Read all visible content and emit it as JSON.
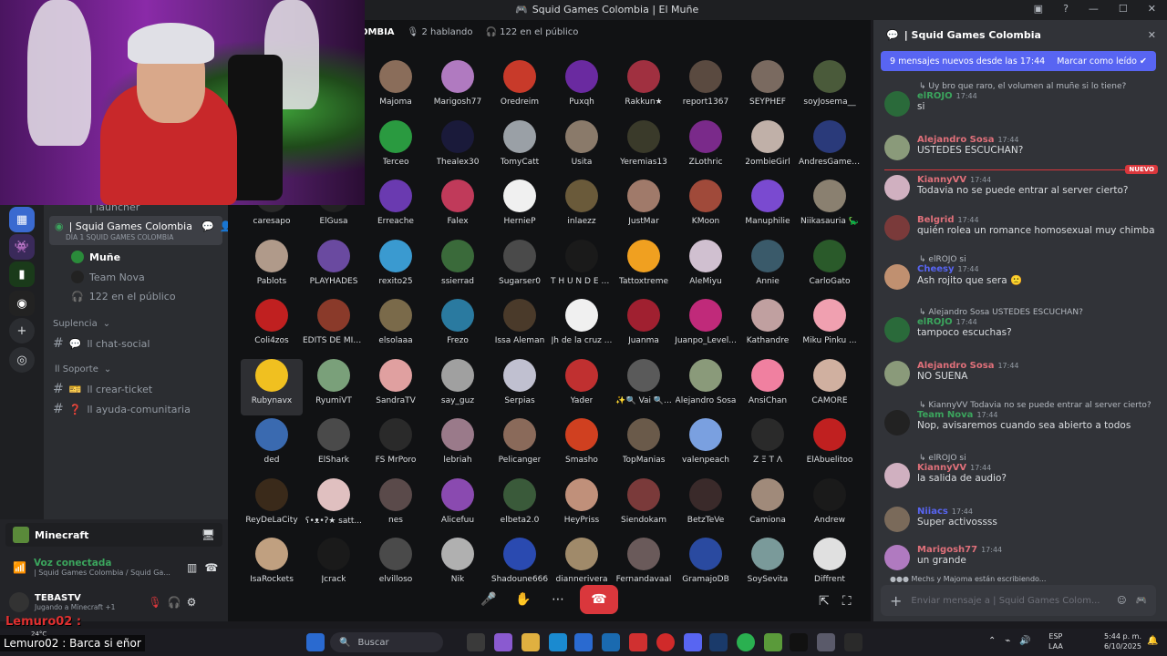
{
  "window": {
    "title": "Squid Games Colombia | El Muñe"
  },
  "stage": {
    "header_partial": "OMBIA",
    "speaking": "2 hablando",
    "public": "122 en el público"
  },
  "sidebar": {
    "partial_launcher": "| launcher",
    "active_channel": "| Squid Games Colombia",
    "active_sub": "DÍA 1 SQUID GAMES COLOMBIA",
    "members": [
      "Muñe",
      "Team Nova"
    ],
    "public_count": "122 en el público",
    "cat_suplencia": "Suplencia",
    "chat_social": "ll chat-social",
    "cat_soporte": "ll Soporte",
    "crear_ticket": "ll crear-ticket",
    "ayuda": "ll ayuda-comunitaria"
  },
  "usercard": {
    "game": "Minecraft",
    "voice_status": "Voz conectada",
    "voice_channel": "| Squid Games Colombia / Squid Ga...",
    "user": "TEBASTV",
    "activity": "Jugando a Minecraft +1"
  },
  "participants": [
    {
      "n": "Majoma",
      "c": "#8a6d5a"
    },
    {
      "n": "Marigosh77",
      "c": "#b07ac0"
    },
    {
      "n": "Oredreim",
      "c": "#c83a2a"
    },
    {
      "n": "Puxqh",
      "c": "#6a2aa0"
    },
    {
      "n": "Rakkun★",
      "c": "#a03040"
    },
    {
      "n": "report1367",
      "c": "#5a4a40"
    },
    {
      "n": "SEYPHEF",
      "c": "#7a6a60"
    },
    {
      "n": "soyJosema__",
      "c": "#4a5a3a"
    },
    {
      "n": "Terceo",
      "c": "#2a9a40"
    },
    {
      "n": "Thealex30",
      "c": "#1a1a3a"
    },
    {
      "n": "TomyCatt",
      "c": "#9aa0a6"
    },
    {
      "n": "Usita",
      "c": "#8a7a6a"
    },
    {
      "n": "Yeremias13",
      "c": "#3a3a2a"
    },
    {
      "n": "ZLothric",
      "c": "#7a2a8a"
    },
    {
      "n": "2ombieGirl",
      "c": "#c0b0a8"
    },
    {
      "n": "AndresGamer...",
      "c": "#2a3a7a"
    },
    {
      "n": "caresapo",
      "c": "#2a2a2a"
    },
    {
      "n": "ElGusa",
      "c": "#222"
    },
    {
      "n": "Erreache",
      "c": "#6a3ab0"
    },
    {
      "n": "Falex",
      "c": "#c03a5a"
    },
    {
      "n": "HernieP",
      "c": "#f0f0f0"
    },
    {
      "n": "inlaezz",
      "c": "#6a5a3a"
    },
    {
      "n": "JustMar",
      "c": "#a07a6a"
    },
    {
      "n": "KMoon",
      "c": "#a04a3a"
    },
    {
      "n": "Manuphilie",
      "c": "#7a4ad0"
    },
    {
      "n": "Niikasauria 🦕",
      "c": "#8a8070"
    },
    {
      "n": "Pablots",
      "c": "#b09a8a"
    },
    {
      "n": "PLAYHADES",
      "c": "#6a4aa0"
    },
    {
      "n": "rexito25",
      "c": "#3a9ad0"
    },
    {
      "n": "ssierrad",
      "c": "#3a6a3a"
    },
    {
      "n": "Sugarser0",
      "c": "#4a4a4a"
    },
    {
      "n": "T H U N D E R...",
      "c": "#1a1a1a"
    },
    {
      "n": "Tattoxtreme",
      "c": "#f0a020"
    },
    {
      "n": "AleMiyu",
      "c": "#d0c0d0"
    },
    {
      "n": "Annie",
      "c": "#3a5a6a"
    },
    {
      "n": "CarloGato",
      "c": "#2a5a2a"
    },
    {
      "n": "Coli4zos",
      "c": "#c02020"
    },
    {
      "n": "EDITS DE MIE...",
      "c": "#8a3a2a"
    },
    {
      "n": "elsolaaa",
      "c": "#7a6a4a"
    },
    {
      "n": "Frezo",
      "c": "#2a7aa0"
    },
    {
      "n": "Issa Aleman",
      "c": "#4a3a2a"
    },
    {
      "n": "Jh de la cruz ...",
      "c": "#f0f0f0"
    },
    {
      "n": "Juanma",
      "c": "#a02030"
    },
    {
      "n": "Juanpo_Level...",
      "c": "#c02a7a"
    },
    {
      "n": "Kathandre",
      "c": "#c0a0a0"
    },
    {
      "n": "Miku Pinku ...",
      "c": "#f0a0b0"
    },
    {
      "n": "Rubynavx",
      "c": "#f0c020"
    },
    {
      "n": "RyumiVT",
      "c": "#7aa07a"
    },
    {
      "n": "SandraTV",
      "c": "#e0a0a0"
    },
    {
      "n": "say_guz",
      "c": "#a0a0a0"
    },
    {
      "n": "Serpias",
      "c": "#c0c0d0"
    },
    {
      "n": "Yader",
      "c": "#c03030"
    },
    {
      "n": "✨🔍 Vai 🔍...",
      "c": "#5a5a5a"
    },
    {
      "n": "Alejandro Sosa",
      "c": "#8a9a7a"
    },
    {
      "n": "AnsiChan",
      "c": "#f080a0"
    },
    {
      "n": "CAMORE",
      "c": "#d0b0a0"
    },
    {
      "n": "ded",
      "c": "#3a6ab0"
    },
    {
      "n": "ElShark",
      "c": "#4a4a4a"
    },
    {
      "n": "FS MrPoro",
      "c": "#2a2a2a"
    },
    {
      "n": "lebriah",
      "c": "#9a7a8a"
    },
    {
      "n": "Pelicanger",
      "c": "#8a6a5a"
    },
    {
      "n": "Smasho",
      "c": "#d04020"
    },
    {
      "n": "TopManias",
      "c": "#6a5a4a"
    },
    {
      "n": "valenpeach",
      "c": "#7aa0e0"
    },
    {
      "n": "Z Ξ T Λ",
      "c": "#2a2a2a"
    },
    {
      "n": "ElAbuelitoo",
      "c": "#c02020"
    },
    {
      "n": "ReyDeLaCity",
      "c": "#3a2a1a"
    },
    {
      "n": "ʕ•ᴥ•ʔ★ satt...",
      "c": "#e0c0c0"
    },
    {
      "n": "nes",
      "c": "#5a4a4a"
    },
    {
      "n": "Alicefuu",
      "c": "#8a4ab0"
    },
    {
      "n": "elbeta2.0",
      "c": "#3a5a3a"
    },
    {
      "n": "HeyPriss",
      "c": "#c0907a"
    },
    {
      "n": "Siendokam",
      "c": "#7a3a3a"
    },
    {
      "n": "BetzTeVe",
      "c": "#3a2a2a"
    },
    {
      "n": "Camiona",
      "c": "#a08a7a"
    },
    {
      "n": "Andrew",
      "c": "#1a1a1a"
    },
    {
      "n": "IsaRockets",
      "c": "#c0a080"
    },
    {
      "n": "Jcrack",
      "c": "#1a1a1a"
    },
    {
      "n": "elvilloso",
      "c": "#4a4a4a"
    },
    {
      "n": "Nik",
      "c": "#b0b0b0"
    },
    {
      "n": "Shadoune666",
      "c": "#2a4ab0"
    },
    {
      "n": "diannerivera",
      "c": "#a08a6a"
    },
    {
      "n": "Fernandavaal",
      "c": "#6a5a5a"
    },
    {
      "n": "GramajoDB",
      "c": "#2a4aa0"
    },
    {
      "n": "SoySevita",
      "c": "#7a9a9a"
    },
    {
      "n": "Diffrent",
      "c": "#e0e0e0"
    }
  ],
  "chat": {
    "title": "| Squid Games Colombia",
    "new_banner": "9 mensajes nuevos desde las 17:44",
    "mark_read": "Marcar como leído",
    "new_badge": "NUEVO",
    "input_placeholder": "Enviar mensaje a | Squid Games Colom...",
    "typing": "Mechs y Majoma están escribiendo...",
    "messages": [
      {
        "reply": "Uy bro que raro, el volumen al muñe si lo tiene?",
        "name": "elROJO",
        "color": "#3ba55d",
        "time": "17:44",
        "text": "si",
        "avc": "#2a6a3a"
      },
      {
        "reply": "",
        "name": "Alejandro Sosa",
        "color": "#e0707a",
        "time": "17:44",
        "text": "USTEDES ESCUCHAN?",
        "avc": "#8a9a7a"
      },
      {
        "reply": "",
        "name": "KiannyVV",
        "color": "#e0707a",
        "time": "17:44",
        "text": "Todavia no se puede entrar al server cierto?",
        "avc": "#d0b0c0"
      },
      {
        "reply": "",
        "name": "Belgrid",
        "color": "#e0707a",
        "time": "17:44",
        "text": "quién rolea un romance homosexual muy chimba",
        "avc": "#7a3a3a"
      },
      {
        "reply": "elROJO si",
        "name": "Cheesy",
        "color": "#5865f2",
        "time": "17:44",
        "text": "Ash rojito que sera 🙁",
        "avc": "#c09070"
      },
      {
        "reply": "Alejandro Sosa USTEDES ESCUCHAN?",
        "name": "elROJO",
        "color": "#3ba55d",
        "time": "17:44",
        "text": "tampoco escuchas?",
        "avc": "#2a6a3a"
      },
      {
        "reply": "",
        "name": "Alejandro Sosa",
        "color": "#e0707a",
        "time": "17:44",
        "text": "NO SUENA",
        "avc": "#8a9a7a"
      },
      {
        "reply": "KiannyVV Todavia no se puede entrar al server cierto?",
        "name": "Team Nova",
        "color": "#3ba55d",
        "time": "17:44",
        "text": "Nop, avisaremos cuando sea abierto a todos",
        "avc": "#222"
      },
      {
        "reply": "elROJO si",
        "name": "KiannyVV",
        "color": "#e0707a",
        "time": "17:44",
        "text": "la salida de audio?",
        "avc": "#d0b0c0"
      },
      {
        "reply": "",
        "name": "Niiacs",
        "color": "#5865f2",
        "time": "17:44",
        "text": "Super activossss",
        "avc": "#7a6a5a"
      },
      {
        "reply": "",
        "name": "Marigosh77",
        "color": "#e0707a",
        "time": "17:44",
        "text": "un grande",
        "avc": "#b07ac0"
      }
    ]
  },
  "overlay": {
    "user": "Lemuro02 :",
    "msg": "Lemuro02 : Barca si eñor"
  },
  "taskbar": {
    "search": "Buscar",
    "weather": "24°C",
    "lang1": "ESP",
    "lang2": "LAA",
    "time": "5:44 p. m.",
    "date": "6/10/2025"
  }
}
